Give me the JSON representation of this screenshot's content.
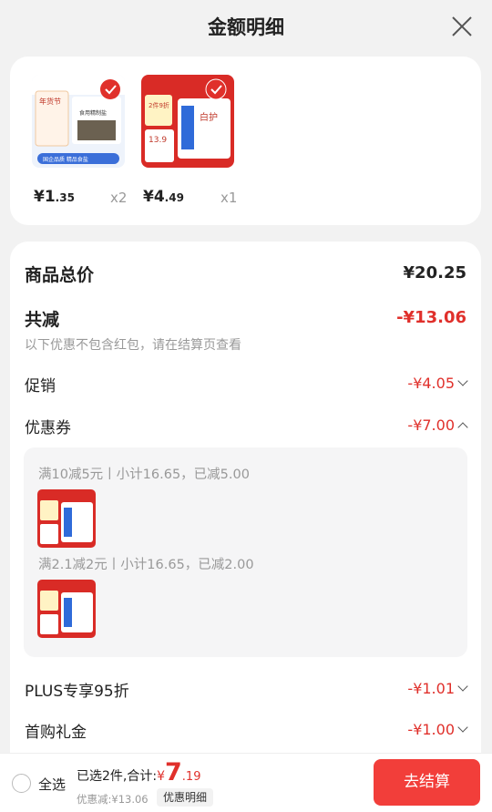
{
  "header": {
    "title": "金额明细"
  },
  "products": [
    {
      "price_int": "¥1",
      "price_dec": ".35",
      "qty": "x2",
      "img_text_a": "年货节",
      "img_text_b": "食用精制盐",
      "img_text_c": "国企品质 精品食盐"
    },
    {
      "price_int": "¥4",
      "price_dec": ".49",
      "qty": "x1",
      "img_text_a": "2件9折",
      "img_text_b": "白护龈",
      "img_text_c": "13.9"
    }
  ],
  "summary": {
    "total_label": "商品总价",
    "total_value": "¥20.25",
    "reduce_label": "共减",
    "reduce_value": "-¥13.06",
    "note": "以下优惠不包含红包，请在结算页查看",
    "promo_label": "促销",
    "promo_value": "-¥4.05",
    "coupon_label": "优惠券",
    "coupon_value": "-¥7.00",
    "plus_label": "PLUS专享95折",
    "plus_value": "-¥1.01",
    "gift_label": "首购礼金",
    "gift_value": "-¥1.00"
  },
  "coupons": [
    {
      "text": "满10减5元丨小计16.65，已减5.00"
    },
    {
      "text": "满2.1减2元丨小计16.65，已减2.00"
    }
  ],
  "bottom": {
    "select_all": "全选",
    "selected_text": "已选2件,合计:",
    "amount_symbol": "¥",
    "amount_int": "7",
    "amount_dec": ".19",
    "sub_text": "优惠减:¥13.06",
    "detail_button": "优惠明细",
    "checkout_button": "去结算"
  },
  "colors": {
    "accent": "#e0302b",
    "checkout": "#f23e3a"
  }
}
